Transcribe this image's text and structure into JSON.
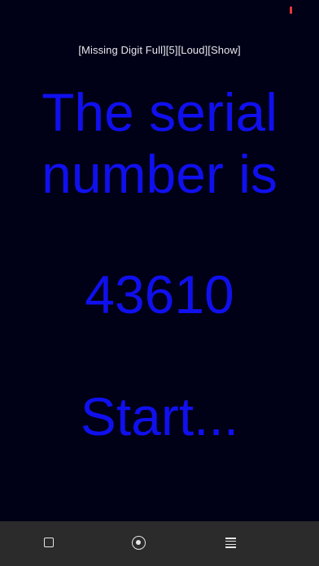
{
  "status_bar": {
    "left_text": "",
    "time_text": ""
  },
  "header": {
    "mode": "[Missing Digit Full][5][Loud][Show]"
  },
  "main": {
    "line1": "The serial",
    "line2": "number is",
    "serial_number": "43610",
    "start_label": "Start..."
  },
  "nav_bar": {
    "buttons": [
      "recents-icon",
      "home-icon",
      "menu-icon"
    ]
  },
  "colors": {
    "background": "#000016",
    "text_accent": "#1010ee",
    "header_text": "#e8e8f0",
    "nav_bar": "#2b2b2b",
    "battery": "#e53935"
  }
}
